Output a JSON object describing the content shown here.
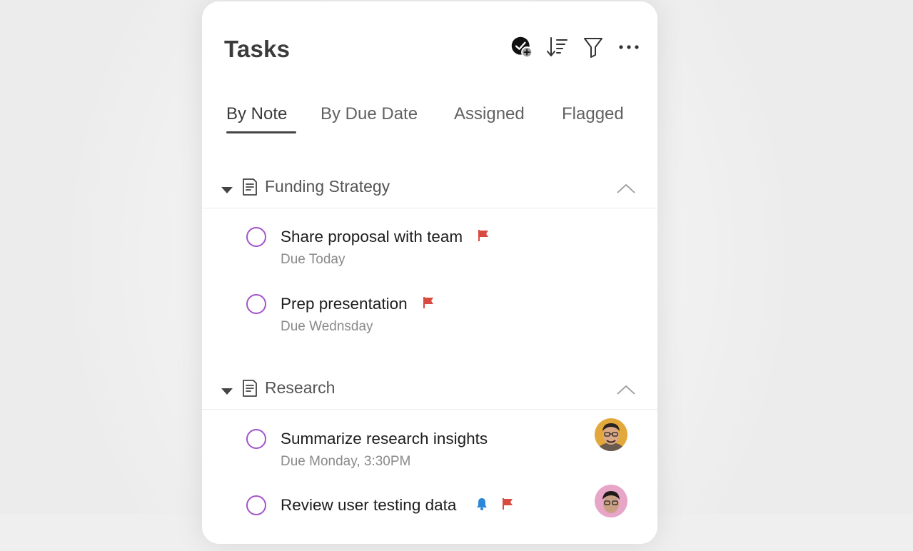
{
  "colors": {
    "accent_check": "#a254c9",
    "flag": "#d94b41",
    "bell": "#2b88d8",
    "text": "#1d1d1d"
  },
  "header": {
    "title": "Tasks",
    "icons": [
      "add-task-icon",
      "sort-icon",
      "filter-icon",
      "more-icon"
    ]
  },
  "tabs": [
    {
      "label": "By Note",
      "active": true
    },
    {
      "label": "By Due Date",
      "active": false
    },
    {
      "label": "Assigned",
      "active": false
    },
    {
      "label": "Flagged",
      "active": false
    }
  ],
  "sections": [
    {
      "title": "Funding Strategy",
      "tasks": [
        {
          "title": "Share proposal with team",
          "due": "Due Today",
          "flagged": true,
          "reminder": false,
          "assignee": null
        },
        {
          "title": "Prep presentation",
          "due": "Due Wednsday",
          "flagged": true,
          "reminder": false,
          "assignee": null
        }
      ]
    },
    {
      "title": "Research",
      "tasks": [
        {
          "title": "Summarize research insights",
          "due": "Due Monday, 3:30PM",
          "flagged": false,
          "reminder": false,
          "assignee": "avatar-man-glasses"
        },
        {
          "title": "Review user testing data",
          "due": "",
          "flagged": true,
          "reminder": true,
          "assignee": "avatar-man-glasses-pink"
        }
      ]
    }
  ]
}
